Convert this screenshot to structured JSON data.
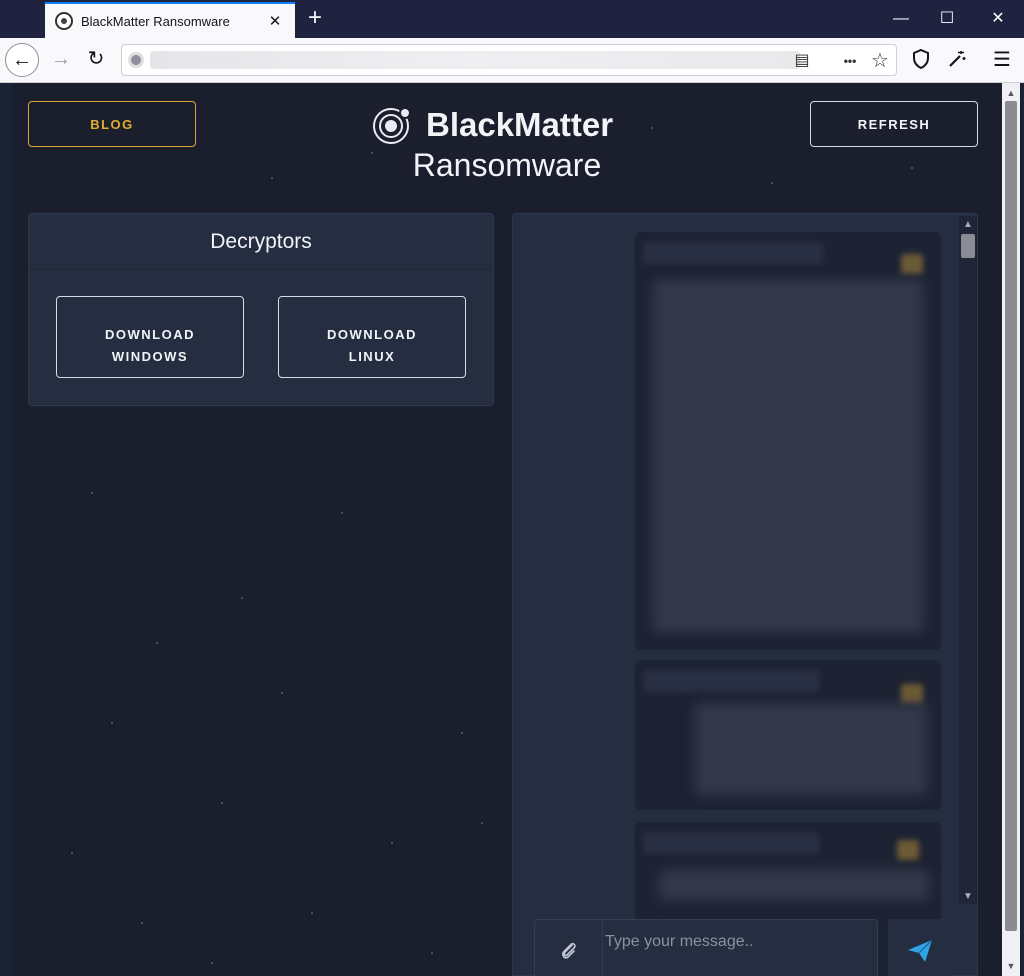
{
  "browser": {
    "tab_title": "BlackMatter Ransomware",
    "tab_close": "✕",
    "new_tab": "+",
    "window_controls": {
      "minimize": "—",
      "maximize": "☐",
      "close": "✕"
    },
    "nav": {
      "back": "←",
      "forward": "→",
      "reload": "↻"
    },
    "url_icons": {
      "reader": "▤",
      "more": "•••",
      "bookmark": "☆"
    },
    "toolbar_icons": {
      "shield": "shield-icon",
      "extension": "wand-icon",
      "menu": "☰"
    }
  },
  "header": {
    "blog_label": "BLOG",
    "refresh_label": "REFRESH",
    "brand_name": "BlackMatter",
    "subtitle": "Ransomware"
  },
  "decryptors": {
    "title": "Decryptors",
    "windows_label_1": "DOWNLOAD",
    "windows_label_2": "WINDOWS",
    "linux_label_1": "DOWNLOAD",
    "linux_label_2": "LINUX"
  },
  "chat": {
    "placeholder": "Type your message..",
    "attach_icon": "paperclip-icon",
    "send_icon": "paper-plane-icon",
    "scroll_up": "▲",
    "scroll_down": "▼"
  },
  "colors": {
    "accent_gold": "#e3ac2c",
    "page_bg": "#1b1f2d",
    "card_bg": "#252d41",
    "send_blue": "#2ea3e6"
  }
}
